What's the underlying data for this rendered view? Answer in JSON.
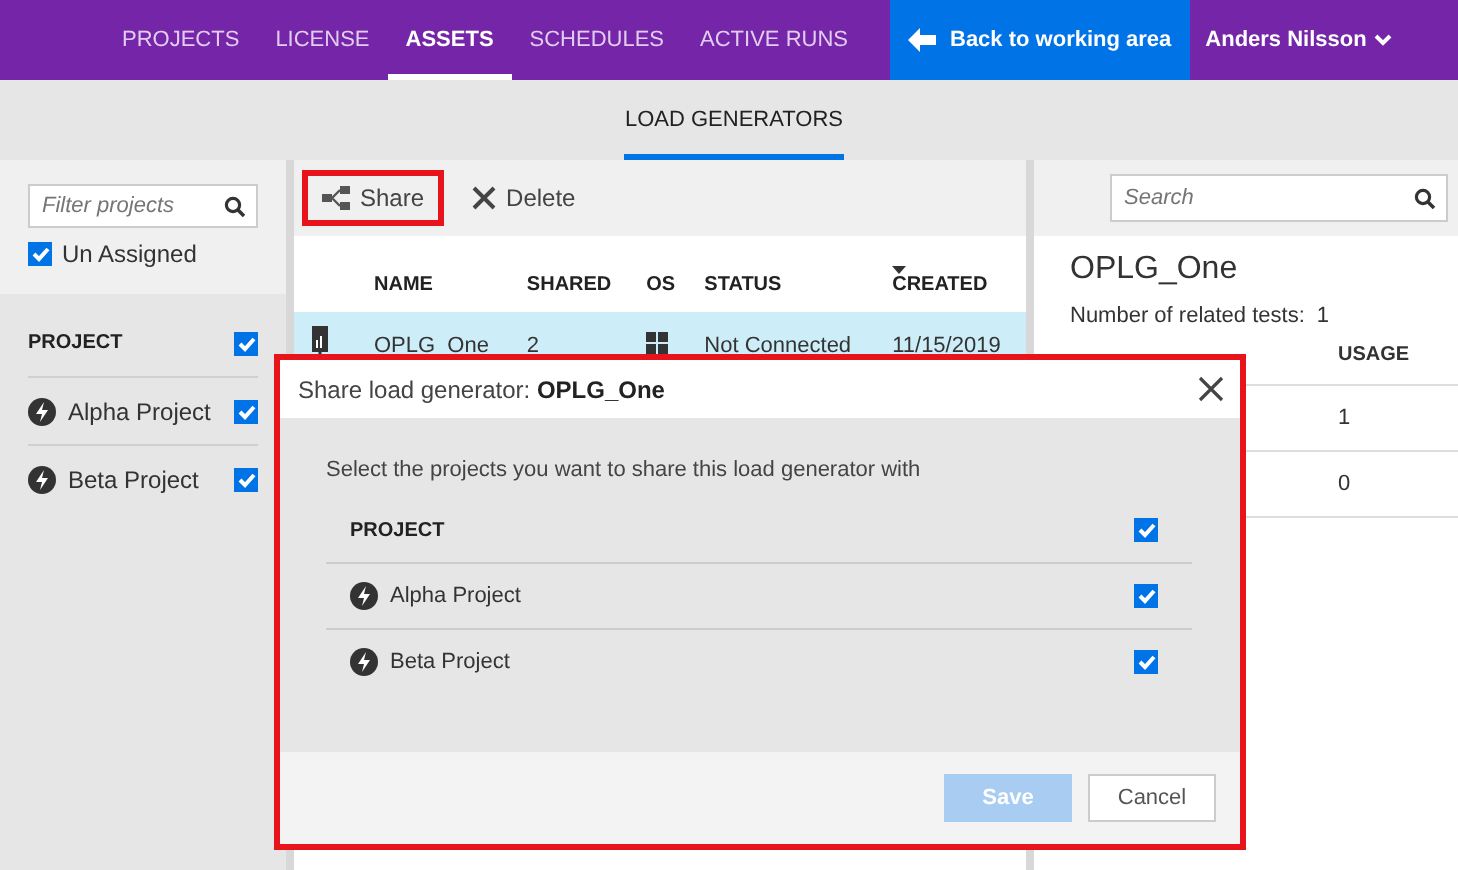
{
  "nav": {
    "items": [
      {
        "label": "PROJECTS",
        "selected": false
      },
      {
        "label": "LICENSE",
        "selected": false
      },
      {
        "label": "ASSETS",
        "selected": true
      },
      {
        "label": "SCHEDULES",
        "selected": false
      },
      {
        "label": "ACTIVE RUNS",
        "selected": false
      }
    ],
    "back_button": "Back to working area",
    "user": "Anders Nilsson"
  },
  "subnav": {
    "tabs": [
      {
        "label": "LOAD GENERATORS",
        "selected": true
      }
    ]
  },
  "sidebar": {
    "filter": {
      "placeholder": "Filter projects"
    },
    "unassigned": {
      "label": "Un Assigned",
      "checked": true
    },
    "header": {
      "label": "PROJECT",
      "checked": true
    },
    "projects": [
      {
        "name": "Alpha Project",
        "checked": true
      },
      {
        "name": "Beta Project",
        "checked": true
      }
    ]
  },
  "toolbar": {
    "buttons": [
      {
        "label": "Share",
        "kind": "share",
        "highlighted": true
      },
      {
        "label": "Delete",
        "kind": "delete",
        "highlighted": false
      }
    ]
  },
  "search": {
    "placeholder": "Search"
  },
  "table": {
    "columns": [
      {
        "label": "NAME",
        "sorted": false
      },
      {
        "label": "SHARED",
        "sorted": false
      },
      {
        "label": "OS",
        "sorted": false
      },
      {
        "label": "STATUS",
        "sorted": false
      },
      {
        "label": "CREATED",
        "sorted": true
      }
    ],
    "rows": [
      {
        "name": "OPLG_One",
        "shared": "2",
        "status": "Not Connected",
        "created": "11/15/2019",
        "selected": true
      }
    ]
  },
  "details": {
    "title": "OPLG_One",
    "related_label": "Number of related tests:",
    "related_count": "1",
    "column": "USAGE",
    "rows": [
      {
        "usage": "1"
      },
      {
        "usage": "0"
      }
    ]
  },
  "dialog": {
    "title": "Share load generator:",
    "name": "OPLG_One",
    "highlighted": true,
    "instruction": "Select the projects you want to share this load generator with",
    "header": {
      "label": "PROJECT",
      "checked": true
    },
    "projects": [
      {
        "name": "Alpha Project",
        "checked": true
      },
      {
        "name": "Beta Project",
        "checked": true
      }
    ],
    "buttons": [
      {
        "label": "Save",
        "kind": "primary",
        "disabled": true
      },
      {
        "label": "Cancel",
        "kind": "secondary",
        "disabled": false
      }
    ]
  }
}
